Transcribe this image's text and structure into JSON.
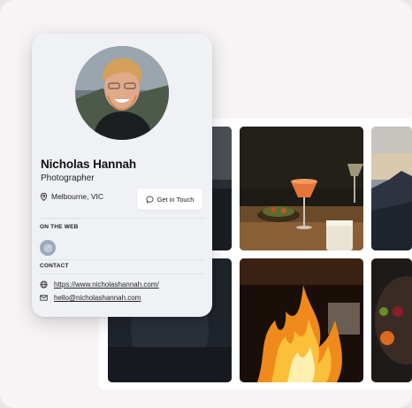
{
  "profile": {
    "name": "Nicholas Hannah",
    "role": "Photographer",
    "location": "Melbourne, VIC",
    "cta_label": "Get in Touch"
  },
  "sections": {
    "web_label": "ON THE WEB",
    "contact_label": "CONTACT"
  },
  "contact": {
    "website": "https://www.nicholashannah.com/",
    "email": "hello@nicholashannah.com"
  },
  "icons": {
    "location": "map-pin-icon",
    "chat": "chat-bubble-icon",
    "instagram": "instagram-icon",
    "globe": "globe-icon",
    "mail": "mail-icon"
  },
  "colors": {
    "card_bg": "#eff1f4",
    "social_icon_bg": "#9aa9bd",
    "page_bg": "#f7f4f6"
  }
}
